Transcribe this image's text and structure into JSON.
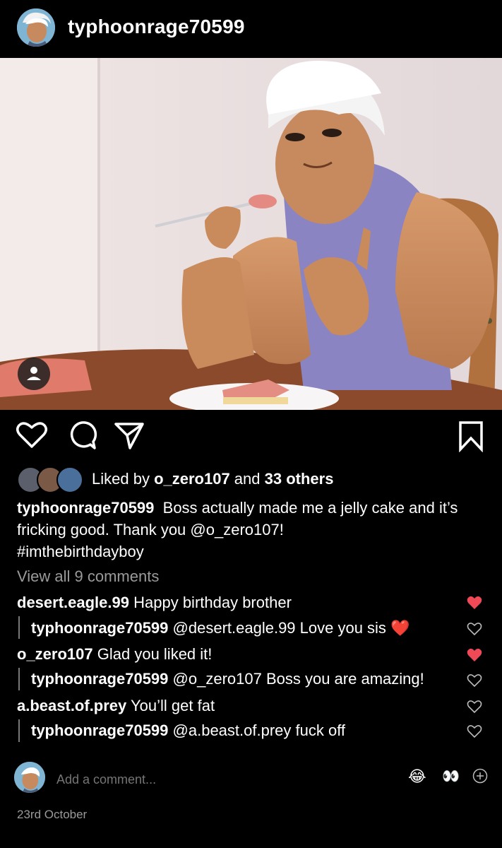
{
  "header": {
    "username": "typhoonrage70599",
    "avatar_icon": "profile-avatar"
  },
  "post": {
    "image_icon": "illustration-white-haired-man-with-spoon-and-cake",
    "tag_icon": "user-tag-icon"
  },
  "actions": {
    "like_icon": "heart-outline-icon",
    "comment_icon": "comment-bubble-icon",
    "share_icon": "paper-plane-icon",
    "save_icon": "bookmark-icon"
  },
  "likes": {
    "prefix": "Liked by ",
    "user": "o_zero107",
    "middle": " and ",
    "others": "33 others"
  },
  "caption": {
    "username": "typhoonrage70599",
    "text": "Boss actually made me a jelly cake and it’s fricking good. Thank you @o_zero107!",
    "hashtag": "#imthebirthdayboy"
  },
  "view_all": "View all 9 comments",
  "comments": [
    {
      "username": "desert.eagle.99",
      "text": "Happy birthday brother",
      "liked": true
    },
    {
      "username": "typhoonrage70599",
      "text": "@desert.eagle.99 Love you sis",
      "emoji": "❤️",
      "liked": false
    },
    {
      "username": "o_zero107",
      "text": "Glad you liked it!",
      "liked": true
    },
    {
      "username": "typhoonrage70599",
      "text": "@o_zero107 Boss you are amazing!",
      "liked": false
    },
    {
      "username": "a.beast.of.prey",
      "text": "You’ll get fat",
      "liked": false
    },
    {
      "username": "typhoonrage70599",
      "text": "@a.beast.of.prey fuck off",
      "liked": false
    }
  ],
  "add_comment": {
    "placeholder": "Add a comment...",
    "emoji_laugh": "😂",
    "emoji_eyes": "👀",
    "plus_icon": "add-circle-icon"
  },
  "date": "23rd October",
  "colors": {
    "background": "#000000",
    "text": "#ffffff",
    "muted": "#9a9a9a",
    "heart": "#ed4956"
  }
}
